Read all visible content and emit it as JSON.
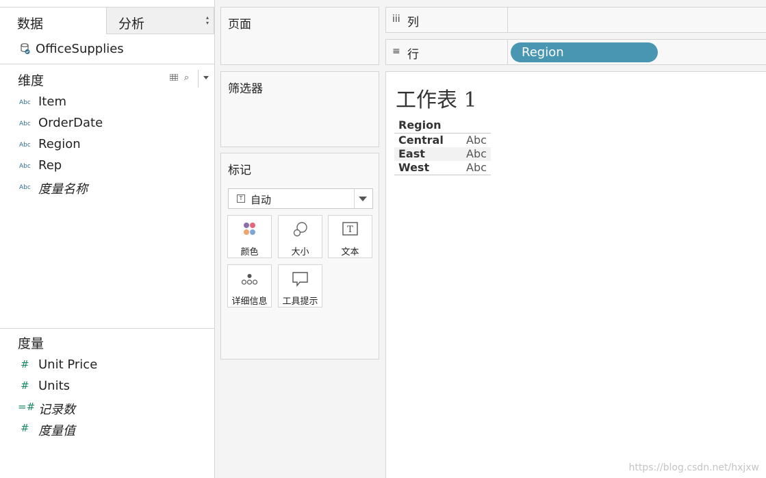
{
  "tabs": {
    "data": "数据",
    "analysis": "分析"
  },
  "datasource": {
    "name": "OfficeSupplies"
  },
  "dimensions": {
    "title": "维度",
    "fields": [
      {
        "label": "Item",
        "type": "Abc"
      },
      {
        "label": "OrderDate",
        "type": "Abc"
      },
      {
        "label": "Region",
        "type": "Abc"
      },
      {
        "label": "Rep",
        "type": "Abc"
      },
      {
        "label": "度量名称",
        "type": "Abc"
      }
    ]
  },
  "measures": {
    "title": "度量",
    "fields": [
      {
        "label": "Unit Price",
        "icon": "#"
      },
      {
        "label": "Units",
        "icon": "#"
      },
      {
        "label": "记录数",
        "icon": "=#"
      },
      {
        "label": "度量值",
        "icon": "#"
      }
    ]
  },
  "pages_card": {
    "title": "页面"
  },
  "filters_card": {
    "title": "筛选器"
  },
  "marks_card": {
    "title": "标记",
    "mark_type": "自动",
    "mark_type_icon": "T",
    "buttons": [
      {
        "label": "颜色",
        "icon": "color-icon"
      },
      {
        "label": "大小",
        "icon": "size-icon"
      },
      {
        "label": "文本",
        "icon": "text-icon",
        "glyph": "T"
      },
      {
        "label": "详细信息",
        "icon": "detail-icon"
      },
      {
        "label": "工具提示",
        "icon": "tooltip-icon"
      }
    ]
  },
  "columns_shelf": {
    "icon": "iii",
    "label": "列"
  },
  "rows_shelf": {
    "icon": "≡",
    "label": "行",
    "pill": "Region"
  },
  "worksheet": {
    "title": "工作表 1",
    "header": "Region",
    "rows": [
      {
        "category": "Central",
        "value": "Abc"
      },
      {
        "category": "East",
        "value": "Abc"
      },
      {
        "category": "West",
        "value": "Abc"
      }
    ]
  },
  "watermark": "https://blog.csdn.net/hxjxw",
  "colors": {
    "pill": "#4996b2",
    "dimension_icon": "#2f6e8e",
    "measure_icon": "#1a8a64"
  }
}
